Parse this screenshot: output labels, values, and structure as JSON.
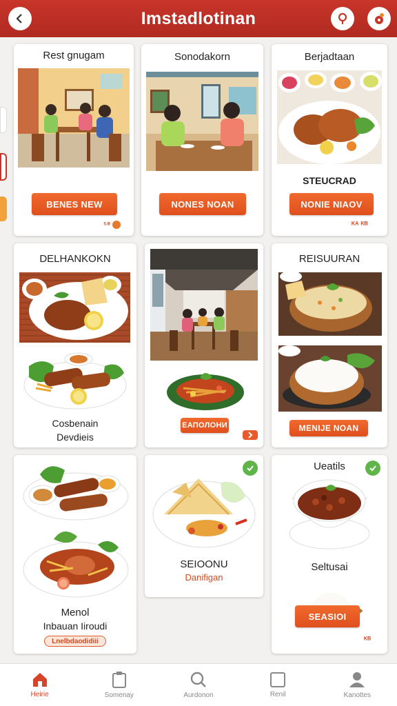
{
  "header": {
    "title": "Imstadlotinan"
  },
  "cards": [
    {
      "title": "Rest gnugam",
      "button": "BENES NEW",
      "badge": "⁵⁸"
    },
    {
      "title": "Sonodakorn",
      "button": "NONES NOAN"
    },
    {
      "title": "Berjadtaan",
      "subtitle": "STEUCRAD",
      "button": "NONIE NIAOV",
      "badge": "ᴷᴬ ᴷᴮ"
    },
    {
      "title": "DELHANKOKN",
      "line1": "Cosbenain",
      "line2": "Devdieis"
    },
    {
      "button": "ЕАПОЛОНИ"
    },
    {
      "title": "REISUURAN",
      "button": "MENIJE NOAN"
    },
    {
      "line1": "Menol",
      "line2": "Inbauan Iiroudi",
      "tag": "Lnelbdaodidiii"
    },
    {
      "line1": "SEIOONU",
      "line2": "Danifigan"
    },
    {
      "title": "Ueatils",
      "line1": "Seltusai",
      "button": "SEASIOI",
      "badge": "ᴷᴮ"
    }
  ],
  "tabbar": {
    "items": [
      {
        "label": "Heirie",
        "icon": "home-icon"
      },
      {
        "label": "Somenay",
        "icon": "clipboard-icon"
      },
      {
        "label": "Aurdonon",
        "icon": "search-icon"
      },
      {
        "label": "Renil",
        "icon": "square-icon"
      },
      {
        "label": "Kanottes",
        "icon": "user-icon"
      }
    ]
  },
  "colors": {
    "brand": "#c8352a",
    "accent": "#e95a24",
    "check": "#5fb54a"
  }
}
